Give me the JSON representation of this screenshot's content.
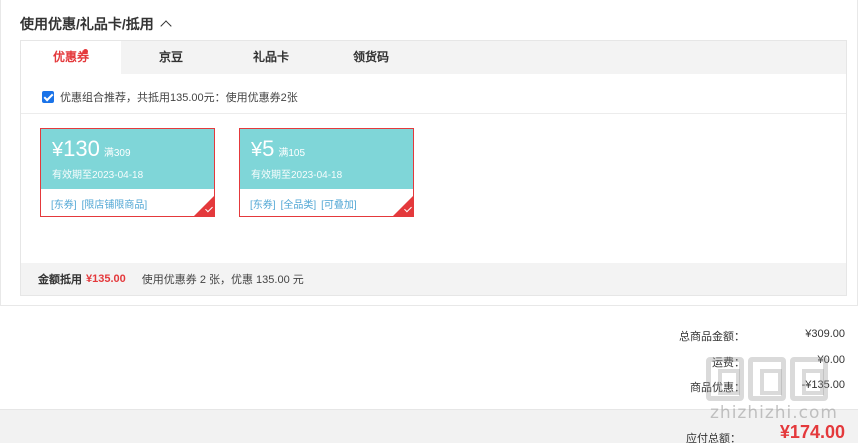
{
  "section": {
    "title": "使用优惠/礼品卡/抵用"
  },
  "tabs": [
    {
      "label": "优惠券",
      "active": true,
      "has_dot": true
    },
    {
      "label": "京豆",
      "active": false
    },
    {
      "label": "礼品卡",
      "active": false
    },
    {
      "label": "领货码",
      "active": false
    }
  ],
  "combo": {
    "checked": true,
    "text": "优惠组合推荐，共抵用135.00元：使用优惠券2张"
  },
  "coupons": [
    {
      "currency": "¥",
      "amount": "130",
      "condition": "满309",
      "valid": "有效期至2023-04-18",
      "tags": [
        "[东券]",
        "[限店铺限商品]"
      ],
      "selected": true
    },
    {
      "currency": "¥",
      "amount": "5",
      "condition": "满105",
      "valid": "有效期至2023-04-18",
      "tags": [
        "[东券]",
        "[全品类]",
        "[可叠加]"
      ],
      "selected": true
    }
  ],
  "summary": {
    "label": "金额抵用",
    "amount": "¥135.00",
    "detail": "使用优惠券 2 张，优惠 135.00 元"
  },
  "totals": {
    "goods_label": "总商品金额：",
    "goods_value": "¥309.00",
    "shipping_label": "运费：",
    "shipping_value": "¥0.00",
    "discount_label": "商品优惠：",
    "discount_value": "-¥135.00"
  },
  "pay": {
    "label": "应付总额：",
    "value": "¥174.00"
  },
  "watermark": {
    "text": "zhizhizhi.com"
  },
  "colors": {
    "accent": "#e4393c",
    "coupon_bg": "#7fd6d8",
    "tag_blue": "#4fa6d4",
    "checkbox": "#1a73e8"
  }
}
